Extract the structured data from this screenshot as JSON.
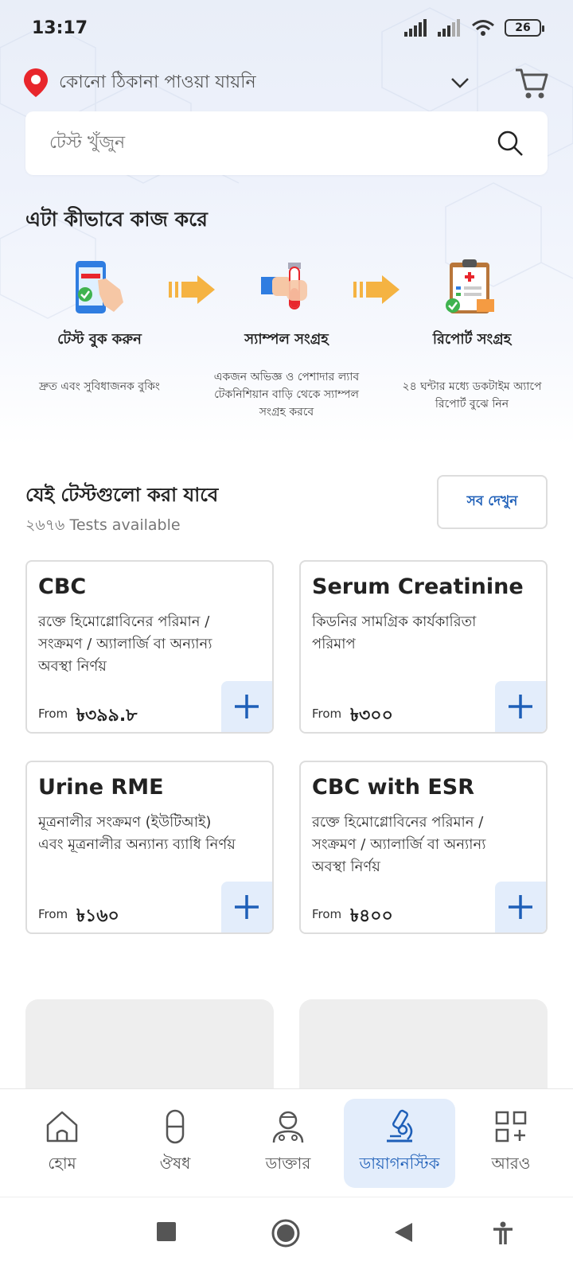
{
  "status": {
    "time": "13:17",
    "battery": "26"
  },
  "location": {
    "text": "কোনো ঠিকানা পাওয়া যায়নি"
  },
  "search": {
    "placeholder": "টেস্ট খুঁজুন"
  },
  "how_it_works": {
    "title": "এটা কীভাবে কাজ করে",
    "steps": [
      {
        "title": "টেস্ট বুক করুন",
        "desc": "দ্রুত এবং সুবিধাজনক বুকিং",
        "icon": "phone-booking-icon"
      },
      {
        "title": "স্যাম্পল সংগ্রহ",
        "desc": "একজন অভিজ্ঞ ও পেশাদার ল্যাব টেকনিশিয়ান বাড়ি থেকে স্যাম্পল সংগ্রহ করবে",
        "icon": "sample-tube-icon"
      },
      {
        "title": "রিপোর্ট সংগ্রহ",
        "desc": "২৪ ঘন্টার মধ্যে ডকটাইম অ্যাপে রিপোর্ট বুঝে নিন",
        "icon": "clipboard-report-icon"
      }
    ]
  },
  "tests": {
    "title": "যেই টেস্টগুলো করা যাবে",
    "count": "২৬৭৬ Tests available",
    "see_all": "সব দেখুন",
    "from_label": "From",
    "items": [
      {
        "name": "CBC",
        "desc": "রক্তে হিমোগ্লোবিনের পরিমান / সংক্রমণ / অ্যালার্জি বা অন্যান্য অবস্থা নির্ণয়",
        "price": "৳৩৯৯.৮"
      },
      {
        "name": "Serum Creatinine",
        "desc": "কিডনির সামগ্রিক কার্যকারিতা পরিমাপ",
        "price": "৳৩০০"
      },
      {
        "name": "Urine RME",
        "desc": "মূত্রনালীর সংক্রমণ (ইউটিআই) এবং মূত্রনালীর অন্যান্য ব্যাধি নির্ণয়",
        "price": "৳১৬০"
      },
      {
        "name": "CBC with ESR",
        "desc": "রক্তে হিমোগ্লোবিনের পরিমান / সংক্রমণ / অ্যালার্জি বা অন্যান্য অবস্থা নির্ণয়",
        "price": "৳৪০০"
      }
    ]
  },
  "bottom_nav": [
    {
      "label": "হোম",
      "icon": "home-icon"
    },
    {
      "label": "ঔষধ",
      "icon": "pill-icon"
    },
    {
      "label": "ডাক্তার",
      "icon": "doctor-icon"
    },
    {
      "label": "ডায়াগনস্টিক",
      "icon": "microscope-icon",
      "active": true
    },
    {
      "label": "আরও",
      "icon": "more-grid-icon"
    }
  ],
  "colors": {
    "accent": "#1e5fb8",
    "location_pin": "#e8262c",
    "arrow": "#f5b342"
  }
}
